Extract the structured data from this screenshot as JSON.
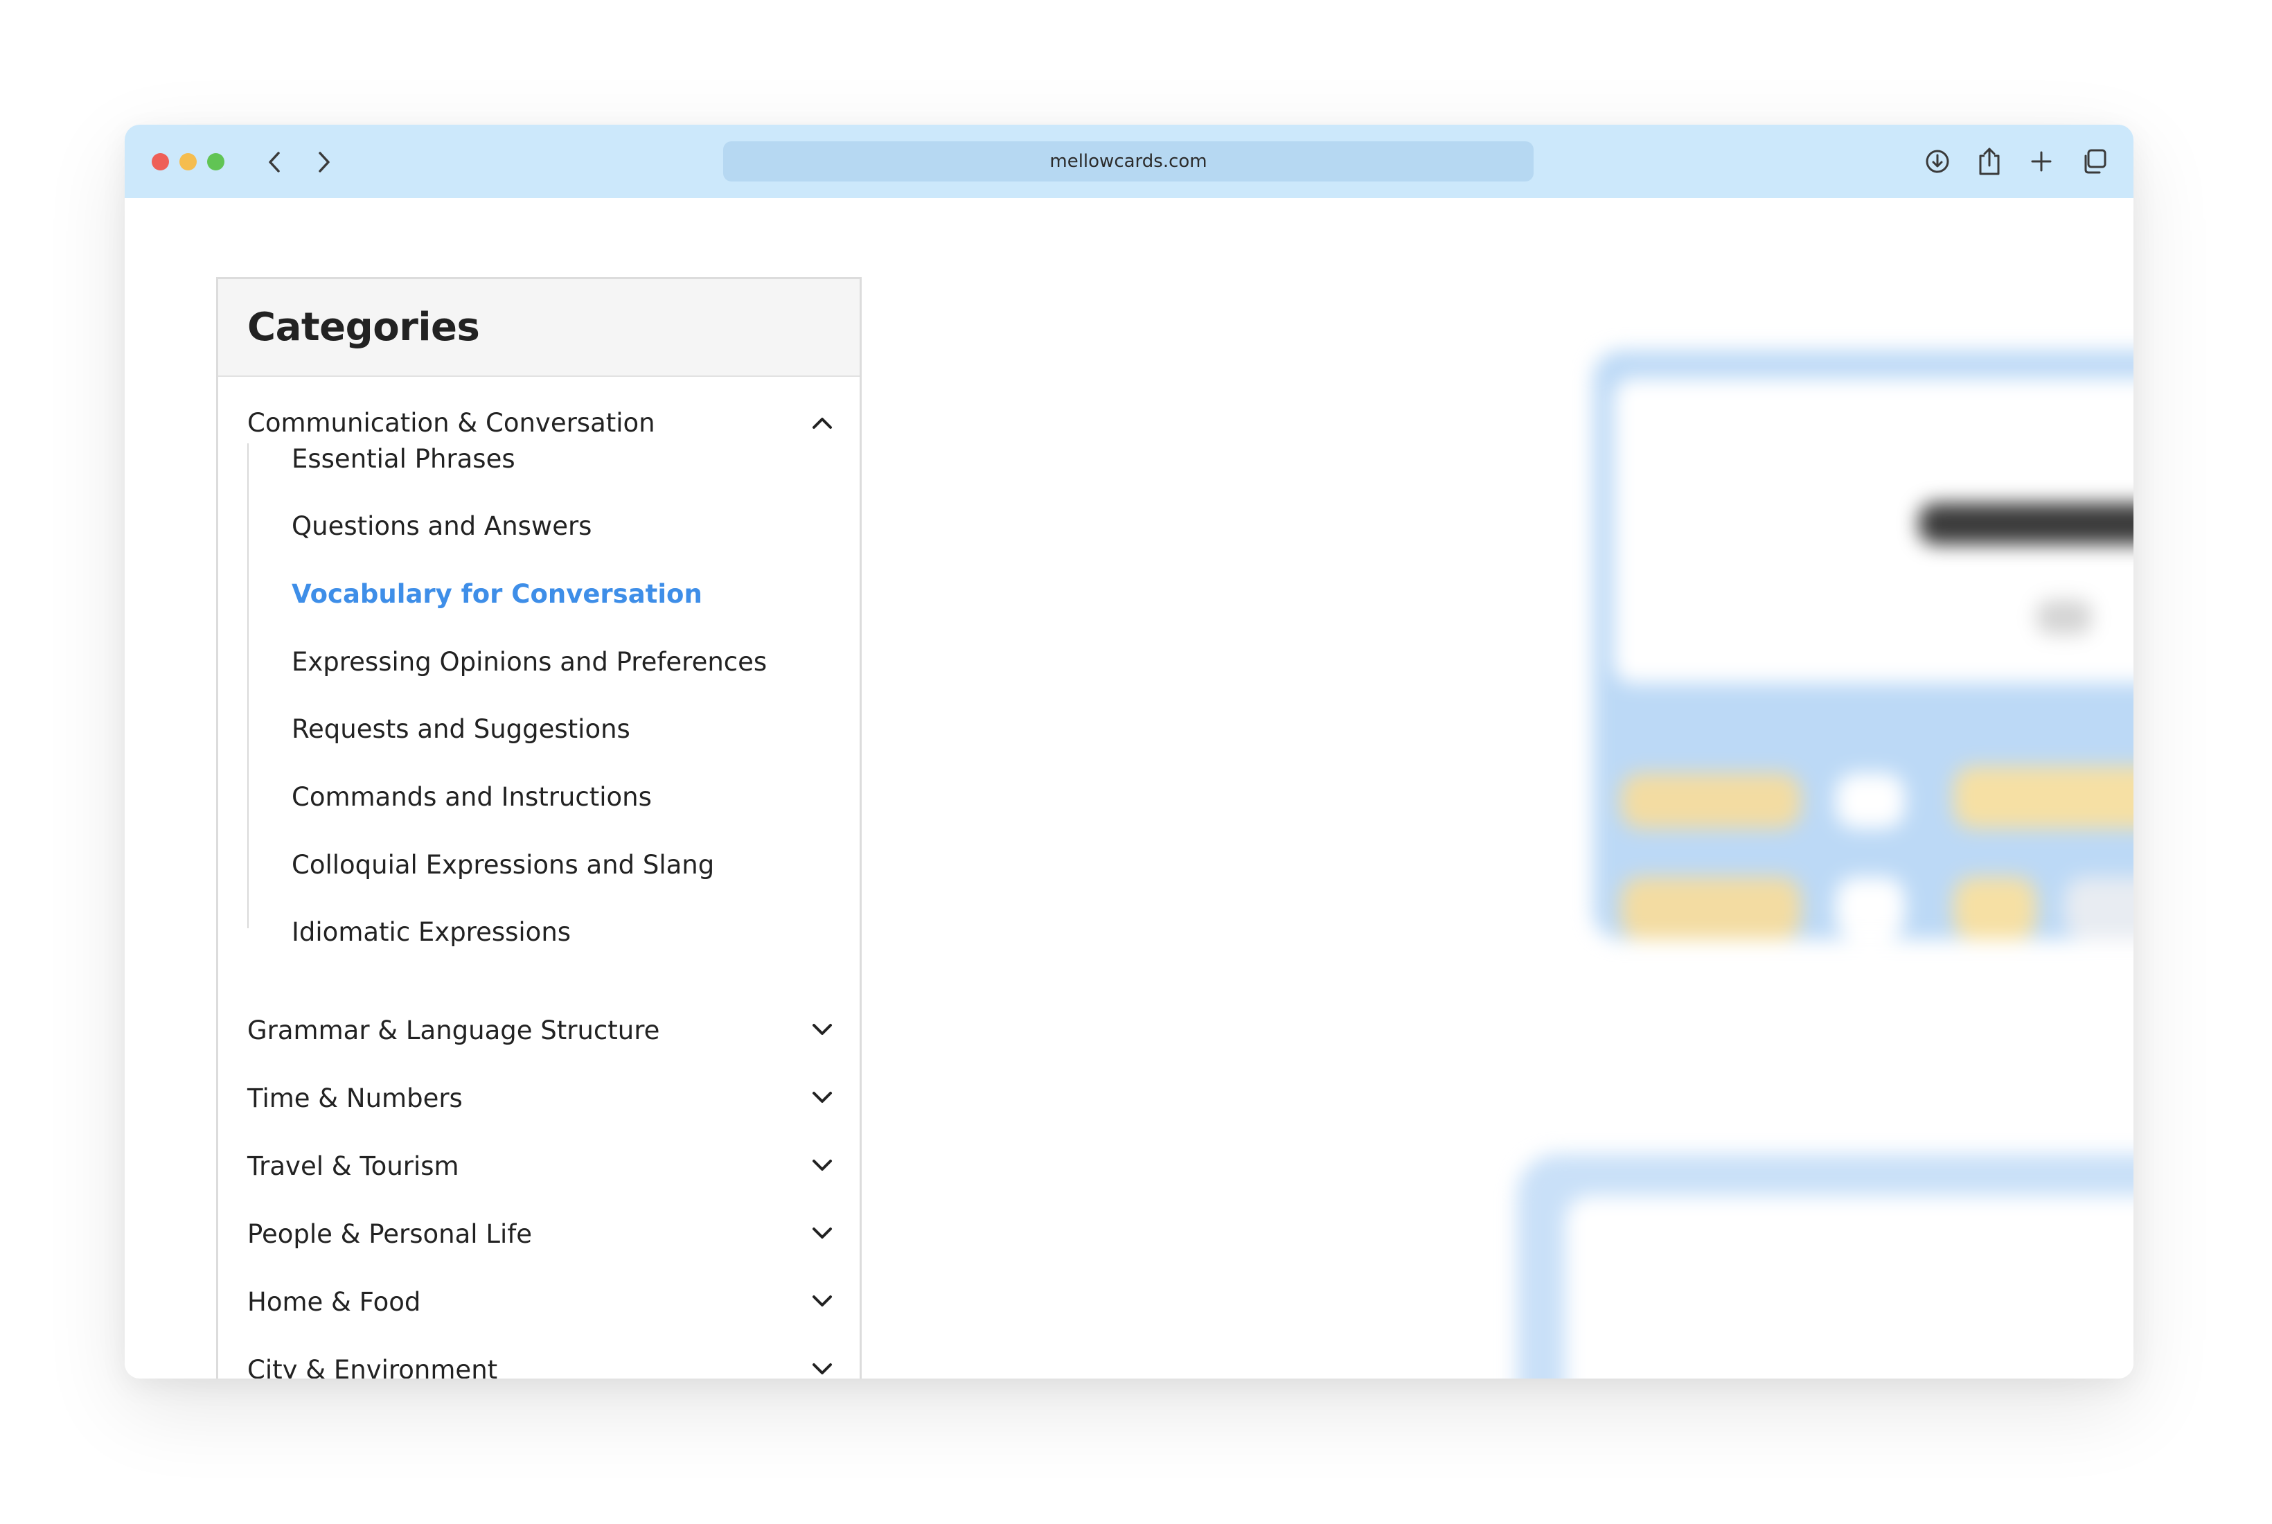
{
  "browser": {
    "url": "mellowcards.com"
  },
  "sidebar": {
    "title": "Categories",
    "expanded_category": "Communication & Conversation",
    "sub_items": [
      "Essential Phrases",
      "Questions and Answers",
      "Vocabulary for Conversation",
      "Expressing Opinions and Preferences",
      "Requests and Suggestions",
      "Commands and Instructions",
      "Colloquial Expressions and Slang",
      "Idiomatic Expressions"
    ],
    "active_sub_item": "Vocabulary for Conversation",
    "other_categories": [
      "Grammar & Language Structure",
      "Time & Numbers",
      "Travel & Tourism",
      "People & Personal Life",
      "Home & Food",
      "City & Environment"
    ]
  },
  "colors": {
    "titlebar": "#cce8fb",
    "urlbar": "#b6d8f2",
    "active_link": "#3e8ee8"
  }
}
